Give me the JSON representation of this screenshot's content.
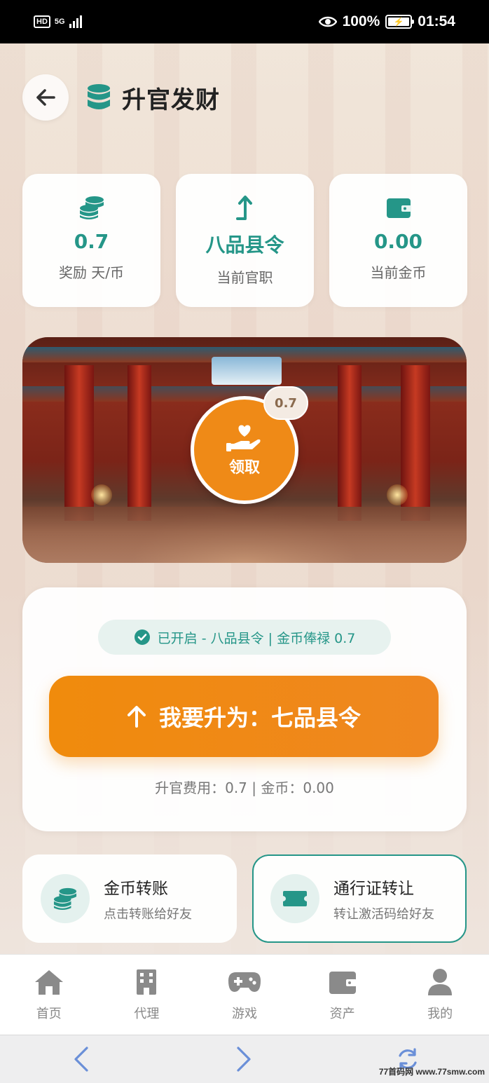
{
  "status_bar": {
    "hd": "HD",
    "network": "5G",
    "battery_percent": "100%",
    "time": "01:54"
  },
  "header": {
    "title": "升官发财",
    "back_icon": "arrow-left-icon",
    "title_icon": "database-icon"
  },
  "stats": [
    {
      "value": "0.7",
      "label": "奖励 天/币",
      "icon": "coins-icon"
    },
    {
      "value": "八品县令",
      "label": "当前官职",
      "icon": "arrow-up-turn-icon"
    },
    {
      "value": "0.00",
      "label": "当前金币",
      "icon": "wallet-icon"
    }
  ],
  "banner": {
    "claim_label": "领取",
    "claim_badge": "0.7",
    "claim_icon": "hand-heart-icon"
  },
  "upgrade": {
    "status_text": "已开启 - 八品县令 | 金币俸禄 0.7",
    "button_label": "我要升为：七品县令",
    "cost_text": "升官费用：0.7 | 金币：0.00"
  },
  "actions": [
    {
      "title": "金币转账",
      "subtitle": "点击转账给好友",
      "icon": "coins-icon"
    },
    {
      "title": "通行证转让",
      "subtitle": "转让激活码给好友",
      "icon": "ticket-icon"
    }
  ],
  "nav": [
    {
      "label": "首页",
      "icon": "home-icon"
    },
    {
      "label": "代理",
      "icon": "building-icon"
    },
    {
      "label": "游戏",
      "icon": "gamepad-icon"
    },
    {
      "label": "资产",
      "icon": "wallet-icon"
    },
    {
      "label": "我的",
      "icon": "user-icon"
    }
  ],
  "watermark": "77首码网 www.77smw.com",
  "colors": {
    "accent": "#259688",
    "orange": "#ef8a17",
    "nav_icon": "#8a8a8a",
    "sys_icon": "#6a8fd8"
  }
}
